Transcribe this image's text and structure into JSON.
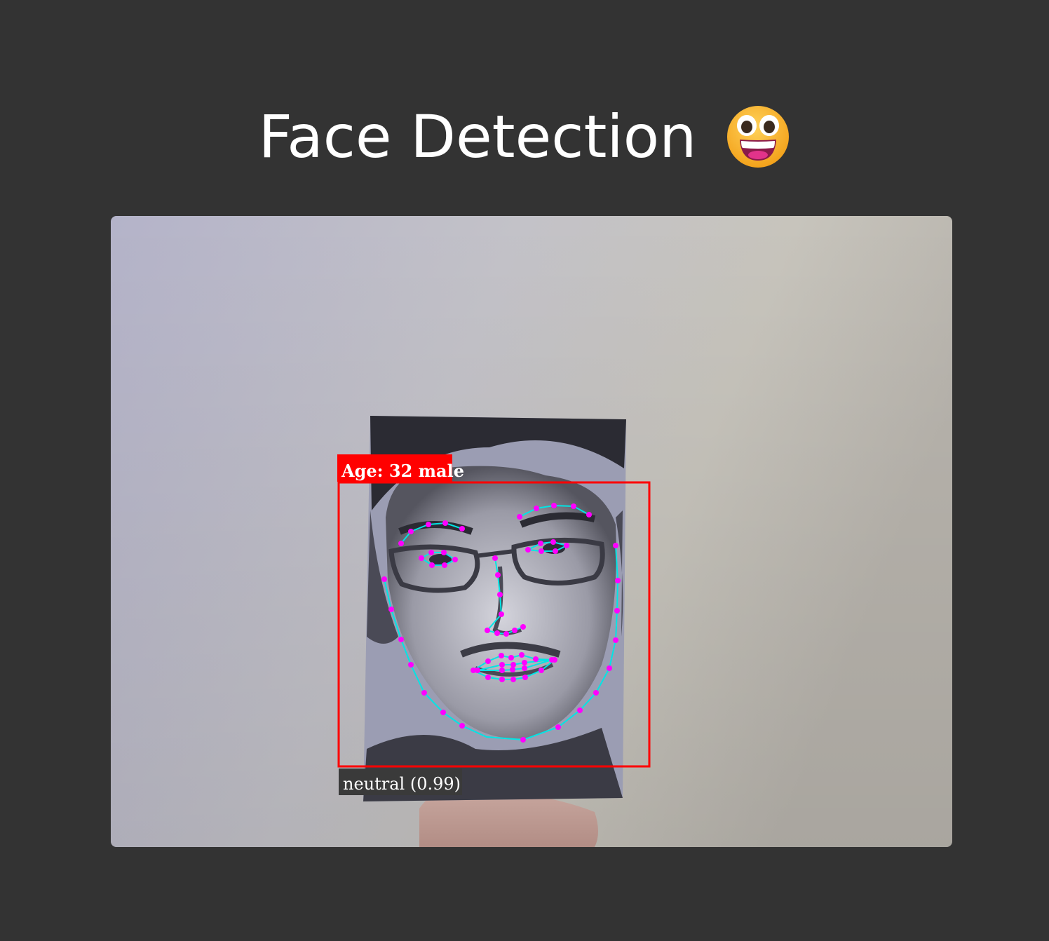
{
  "page": {
    "title": "Face Detection",
    "title_emoji": "grinning-face-emoji"
  },
  "detection": {
    "label_top": "Age: 32 male",
    "label_bottom": "neutral (0.99)",
    "box_color": "#ff0000",
    "landmark_line_color": "#00e5e5",
    "landmark_point_color": "#ff00ff"
  },
  "colors": {
    "background": "#333333",
    "title_text": "#ffffff"
  }
}
